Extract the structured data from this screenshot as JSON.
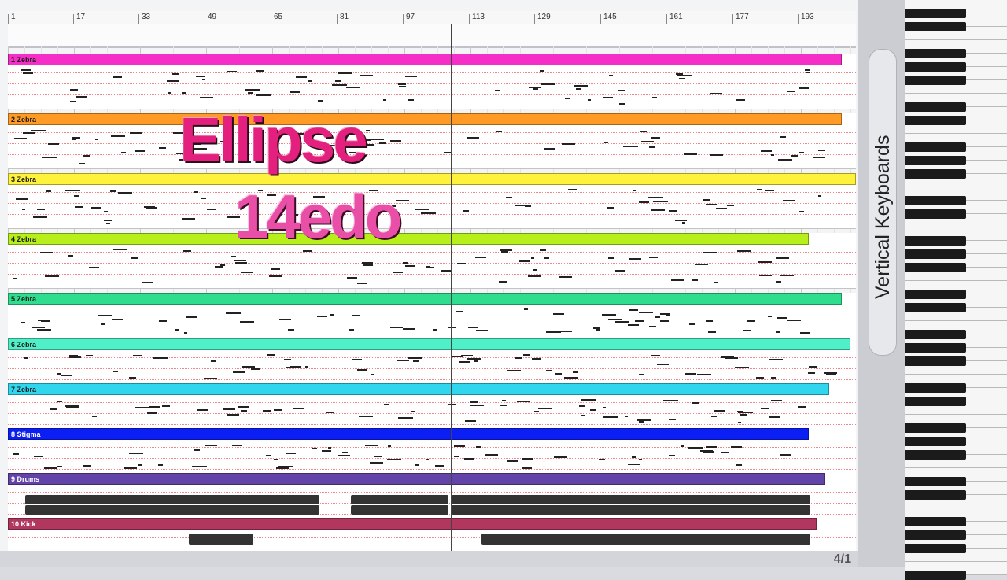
{
  "ruler": {
    "bars": [
      "1",
      "17",
      "33",
      "49",
      "65",
      "81",
      "97",
      "113",
      "129",
      "145",
      "161",
      "177",
      "193"
    ]
  },
  "tracks": [
    {
      "label": "1 Zebra",
      "color": "#f52ec8"
    },
    {
      "label": "2 Zebra",
      "color": "#ff9a24"
    },
    {
      "label": "3 Zebra",
      "color": "#fff23b"
    },
    {
      "label": "4 Zebra",
      "color": "#b7ef1a"
    },
    {
      "label": "5 Zebra",
      "color": "#2fdd8e"
    },
    {
      "label": "6 Zebra",
      "color": "#4ff0c8"
    },
    {
      "label": "7 Zebra",
      "color": "#2fd6ee"
    },
    {
      "label": "8 Stigma",
      "color": "#0b1ff5"
    },
    {
      "label": "9 Drums",
      "color": "#6244a8"
    },
    {
      "label": "10 Kick",
      "color": "#b1375f"
    }
  ],
  "overlay": {
    "title": "Ellipse",
    "subtitle": "14edo"
  },
  "position_display": "4/1",
  "keyboard": {
    "title": "Vertical Keyboards"
  }
}
